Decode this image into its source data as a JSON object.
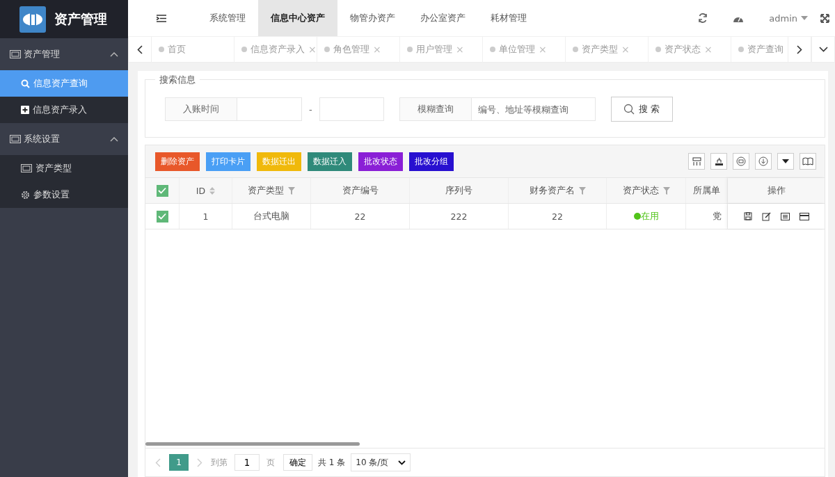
{
  "app": {
    "title": "资产管理"
  },
  "top_nav": [
    {
      "label": "系统管理",
      "selected": false
    },
    {
      "label": "信息中心资产",
      "selected": true
    },
    {
      "label": "物管办资产",
      "selected": false
    },
    {
      "label": "办公室资产",
      "selected": false
    },
    {
      "label": "耗材管理",
      "selected": false
    }
  ],
  "user": {
    "name": "admin"
  },
  "sidebar": [
    {
      "label": "资产管理",
      "expanded": true,
      "children": [
        {
          "label": "信息资产查询",
          "kind": "search",
          "selected": true
        },
        {
          "label": "信息资产录入",
          "kind": "plus",
          "selected": false
        }
      ]
    },
    {
      "label": "系统设置",
      "expanded": true,
      "children": [
        {
          "label": "资产类型",
          "kind": "grid",
          "selected": false
        },
        {
          "label": "参数设置",
          "kind": "gear",
          "selected": false
        }
      ]
    }
  ],
  "tabs": [
    {
      "label": "首页"
    },
    {
      "label": "信息资产录入",
      "close": "×"
    },
    {
      "label": "角色管理",
      "close": "×"
    },
    {
      "label": "用户管理",
      "close": "×"
    },
    {
      "label": "单位管理",
      "close": "×"
    },
    {
      "label": "资产类型",
      "close": "×"
    },
    {
      "label": "资产状态",
      "close": "×"
    },
    {
      "label": "资产查询"
    }
  ],
  "search": {
    "legend": "搜索信息",
    "date_label": "入账时间",
    "separator": "-",
    "fuzzy_label": "模糊查询",
    "fuzzy_placeholder": "编号、地址等模糊查询",
    "button": "搜 索"
  },
  "actions": [
    {
      "label": "删除资产",
      "color": "#e8582a"
    },
    {
      "label": "打印卡片",
      "color": "#4a9ff5"
    },
    {
      "label": "数据迁出",
      "color": "#f0b90b"
    },
    {
      "label": "数据迁入",
      "color": "#2f8a7a"
    },
    {
      "label": "批改状态",
      "color": "#8a1fd6"
    },
    {
      "label": "批改分组",
      "color": "#2810d0"
    }
  ],
  "table": {
    "all_checked": true,
    "columns": [
      {
        "label": "ID",
        "kind": "sort"
      },
      {
        "label": "资产类型",
        "kind": "filter"
      },
      {
        "label": "资产编号",
        "kind": "plain"
      },
      {
        "label": "序列号",
        "kind": "plain"
      },
      {
        "label": "财务资产名",
        "kind": "filter"
      },
      {
        "label": "资产状态",
        "kind": "filter"
      },
      {
        "label": "所属单",
        "kind": "plain"
      }
    ],
    "ops_label": "操作",
    "rows": [
      {
        "checked": true,
        "cells": [
          "1",
          "台式电脑",
          "22",
          "222",
          "22",
          "在用",
          "党"
        ],
        "color": "#52c41a"
      }
    ]
  },
  "pagination": {
    "current": "1",
    "goto_label": "到第",
    "goto_value": "1",
    "page_unit": "页",
    "confirm": "确定",
    "total": "共 1 条",
    "page_size": "10 条/页"
  }
}
